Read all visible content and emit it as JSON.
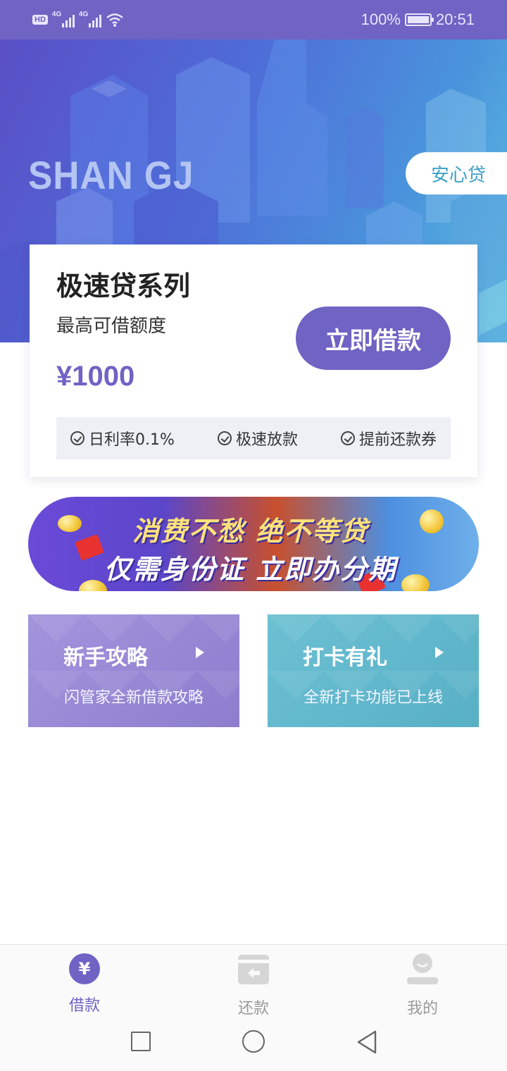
{
  "status_bar": {
    "battery_text": "100%",
    "time": "20:51",
    "network": "4G"
  },
  "hero": {
    "brand": "SHAN GJ",
    "tag": "安心贷"
  },
  "card": {
    "title": "极速贷系列",
    "subtitle": "最高可借额度",
    "amount": "¥1000",
    "borrow_button": "立即借款",
    "features": [
      "日利率0.1%",
      "极速放款",
      "提前还款券"
    ]
  },
  "promo": {
    "line1": "消费不愁 绝不等贷",
    "line2": "仅需身份证 立即办分期"
  },
  "tiles": [
    {
      "title": "新手攻略",
      "desc": "闪管家全新借款攻略"
    },
    {
      "title": "打卡有礼",
      "desc": "全新打卡功能已上线"
    }
  ],
  "bottom_nav": [
    {
      "label": "借款",
      "icon": "yen-icon",
      "active": true
    },
    {
      "label": "还款",
      "icon": "repay-card-icon",
      "active": false
    },
    {
      "label": "我的",
      "icon": "profile-icon",
      "active": false
    }
  ],
  "colors": {
    "primary": "#6f63c4",
    "teal": "#58b0c6",
    "lavender": "#9a8cd6"
  }
}
